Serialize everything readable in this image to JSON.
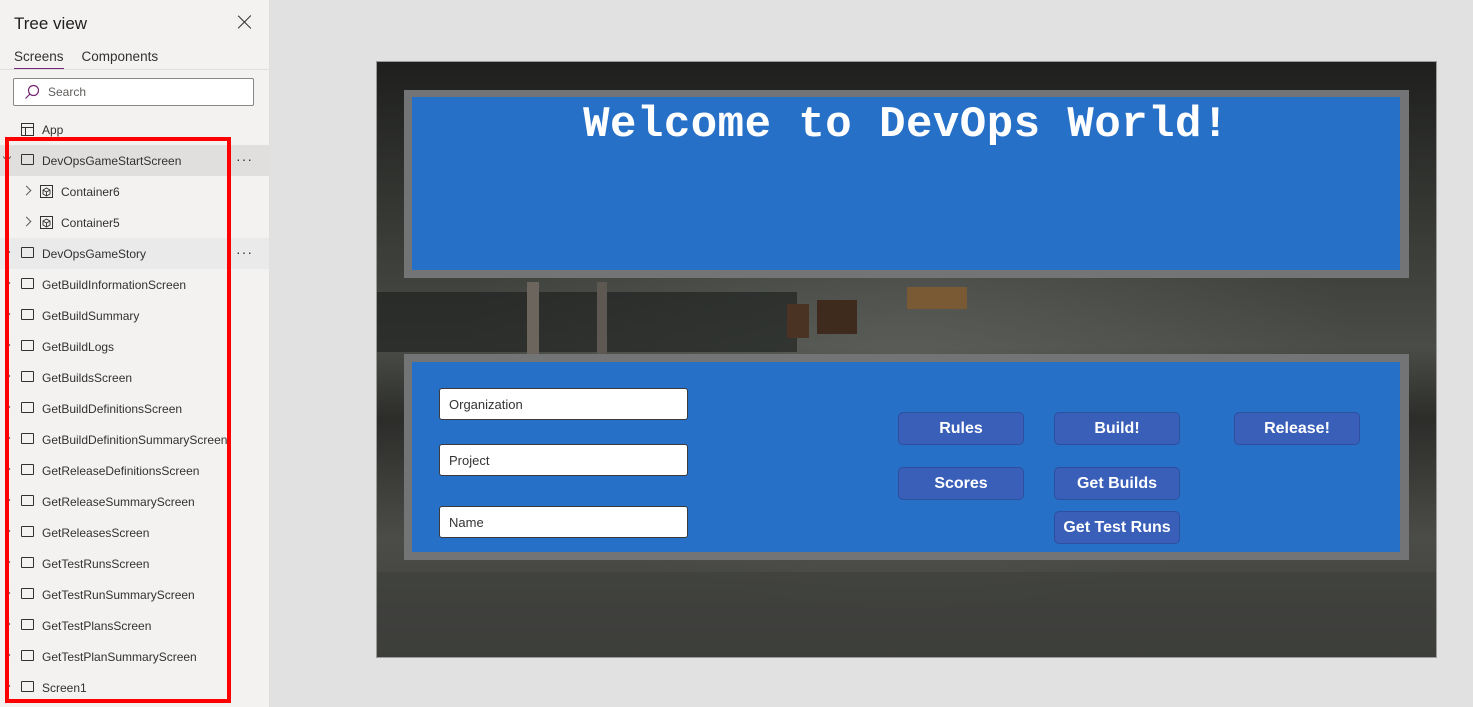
{
  "tree_panel": {
    "title": "Tree view",
    "tabs": [
      "Screens",
      "Components"
    ],
    "active_tab": "Screens",
    "search_placeholder": "Search",
    "app_label": "App",
    "items": [
      {
        "label": "DevOpsGameStartScreen",
        "type": "screen",
        "expanded": true,
        "selected": true
      },
      {
        "label": "Container6",
        "type": "container"
      },
      {
        "label": "Container5",
        "type": "container"
      },
      {
        "label": "DevOpsGameStory",
        "type": "screen"
      },
      {
        "label": "GetBuildInformationScreen",
        "type": "screen"
      },
      {
        "label": "GetBuildSummary",
        "type": "screen"
      },
      {
        "label": "GetBuildLogs",
        "type": "screen"
      },
      {
        "label": "GetBuildsScreen",
        "type": "screen"
      },
      {
        "label": "GetBuildDefinitionsScreen",
        "type": "screen"
      },
      {
        "label": "GetBuildDefinitionSummaryScreen",
        "type": "screen"
      },
      {
        "label": "GetReleaseDefinitionsScreen",
        "type": "screen"
      },
      {
        "label": "GetReleaseSummaryScreen",
        "type": "screen"
      },
      {
        "label": "GetReleasesScreen",
        "type": "screen"
      },
      {
        "label": "GetTestRunsScreen",
        "type": "screen"
      },
      {
        "label": "GetTestRunSummaryScreen",
        "type": "screen"
      },
      {
        "label": "GetTestPlansScreen",
        "type": "screen"
      },
      {
        "label": "GetTestPlanSummaryScreen",
        "type": "screen"
      },
      {
        "label": "Screen1",
        "type": "screen"
      }
    ],
    "more_label": "···",
    "highlight_color": "#ff0000"
  },
  "canvas": {
    "welcome": "Welcome to DevOps World!",
    "fields": {
      "organization": "Organization",
      "project": "Project",
      "name": "Name"
    },
    "buttons": {
      "rules": "Rules",
      "build": "Build!",
      "release": "Release!",
      "scores": "Scores",
      "get_builds": "Get Builds",
      "get_test_runs": "Get Test Runs"
    },
    "colors": {
      "panel_blue": "#2770c7",
      "frame_gray": "#727476",
      "button_blue": "#3a5fb9"
    }
  }
}
